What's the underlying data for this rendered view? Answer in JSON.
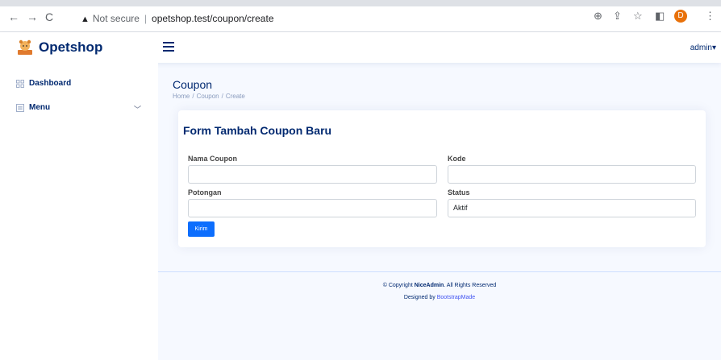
{
  "browser": {
    "back_icon": "←",
    "forward_icon": "→",
    "reload_icon": "C",
    "warning_icon": "▲",
    "security_text": "Not secure",
    "url": "opetshop.test/coupon/create",
    "zoom_icon": "⊕",
    "share_icon": "⇪",
    "star_icon": "☆",
    "sidepanel_icon": "◧",
    "profile_initial": "D",
    "menu_icon": "⋮"
  },
  "header": {
    "brand": "Opetshop",
    "user": "admin",
    "user_caret": "▾"
  },
  "sidebar": {
    "items": [
      {
        "label": "Dashboard",
        "icon": "grid-icon"
      },
      {
        "label": "Menu",
        "icon": "menu-list-icon",
        "chevron": "﹀"
      }
    ]
  },
  "page": {
    "title": "Coupon",
    "breadcrumb": [
      "Home",
      "Coupon",
      "Create"
    ]
  },
  "form": {
    "title": "Form Tambah Coupon Baru",
    "fields": {
      "nama_coupon": {
        "label": "Nama Coupon",
        "value": ""
      },
      "kode": {
        "label": "Kode",
        "value": ""
      },
      "potongan": {
        "label": "Potongan",
        "value": ""
      },
      "status": {
        "label": "Status",
        "value": "Aktif"
      }
    },
    "submit_label": "Kirim"
  },
  "footer": {
    "copyright_prefix": "© Copyright ",
    "copyright_brand": "NiceAdmin",
    "copyright_suffix": ". All Rights Reserved",
    "designed_prefix": "Designed by ",
    "designed_link": "BootstrapMade"
  },
  "colors": {
    "brand": "#012970",
    "primary_button": "#0d6efd",
    "link": "#4154f1",
    "page_bg": "#f6f9ff"
  }
}
